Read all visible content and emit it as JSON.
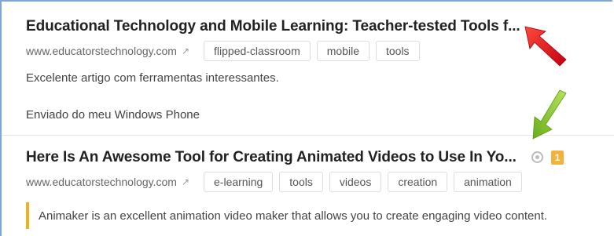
{
  "items": [
    {
      "title": "Educational Technology and Mobile Learning: Teacher-tested Tools f...",
      "domain": "www.educatorstechnology.com",
      "tags": [
        "flipped-classroom",
        "mobile",
        "tools"
      ],
      "notes": [
        "Excelente artigo com ferramentas interessantes.",
        "Enviado do meu Windows Phone"
      ]
    },
    {
      "title": "Here Is An Awesome Tool for Creating Animated Videos to Use In Yo...",
      "domain": "www.educatorstechnology.com",
      "tags": [
        "e-learning",
        "tools",
        "videos",
        "creation",
        "animation"
      ],
      "comment_count": "1",
      "highlight": "Animaker is an excellent animation video maker that allows you to create engaging video content."
    }
  ],
  "icons": {
    "external_link": "↗",
    "share": "share-icon"
  },
  "colors": {
    "frame_border": "#7fa6d6",
    "badge": "#f4b23a",
    "highlight_bar": "#f2b01e",
    "red_arrow": "#e8131a",
    "green_arrow": "#8ccc2a"
  }
}
